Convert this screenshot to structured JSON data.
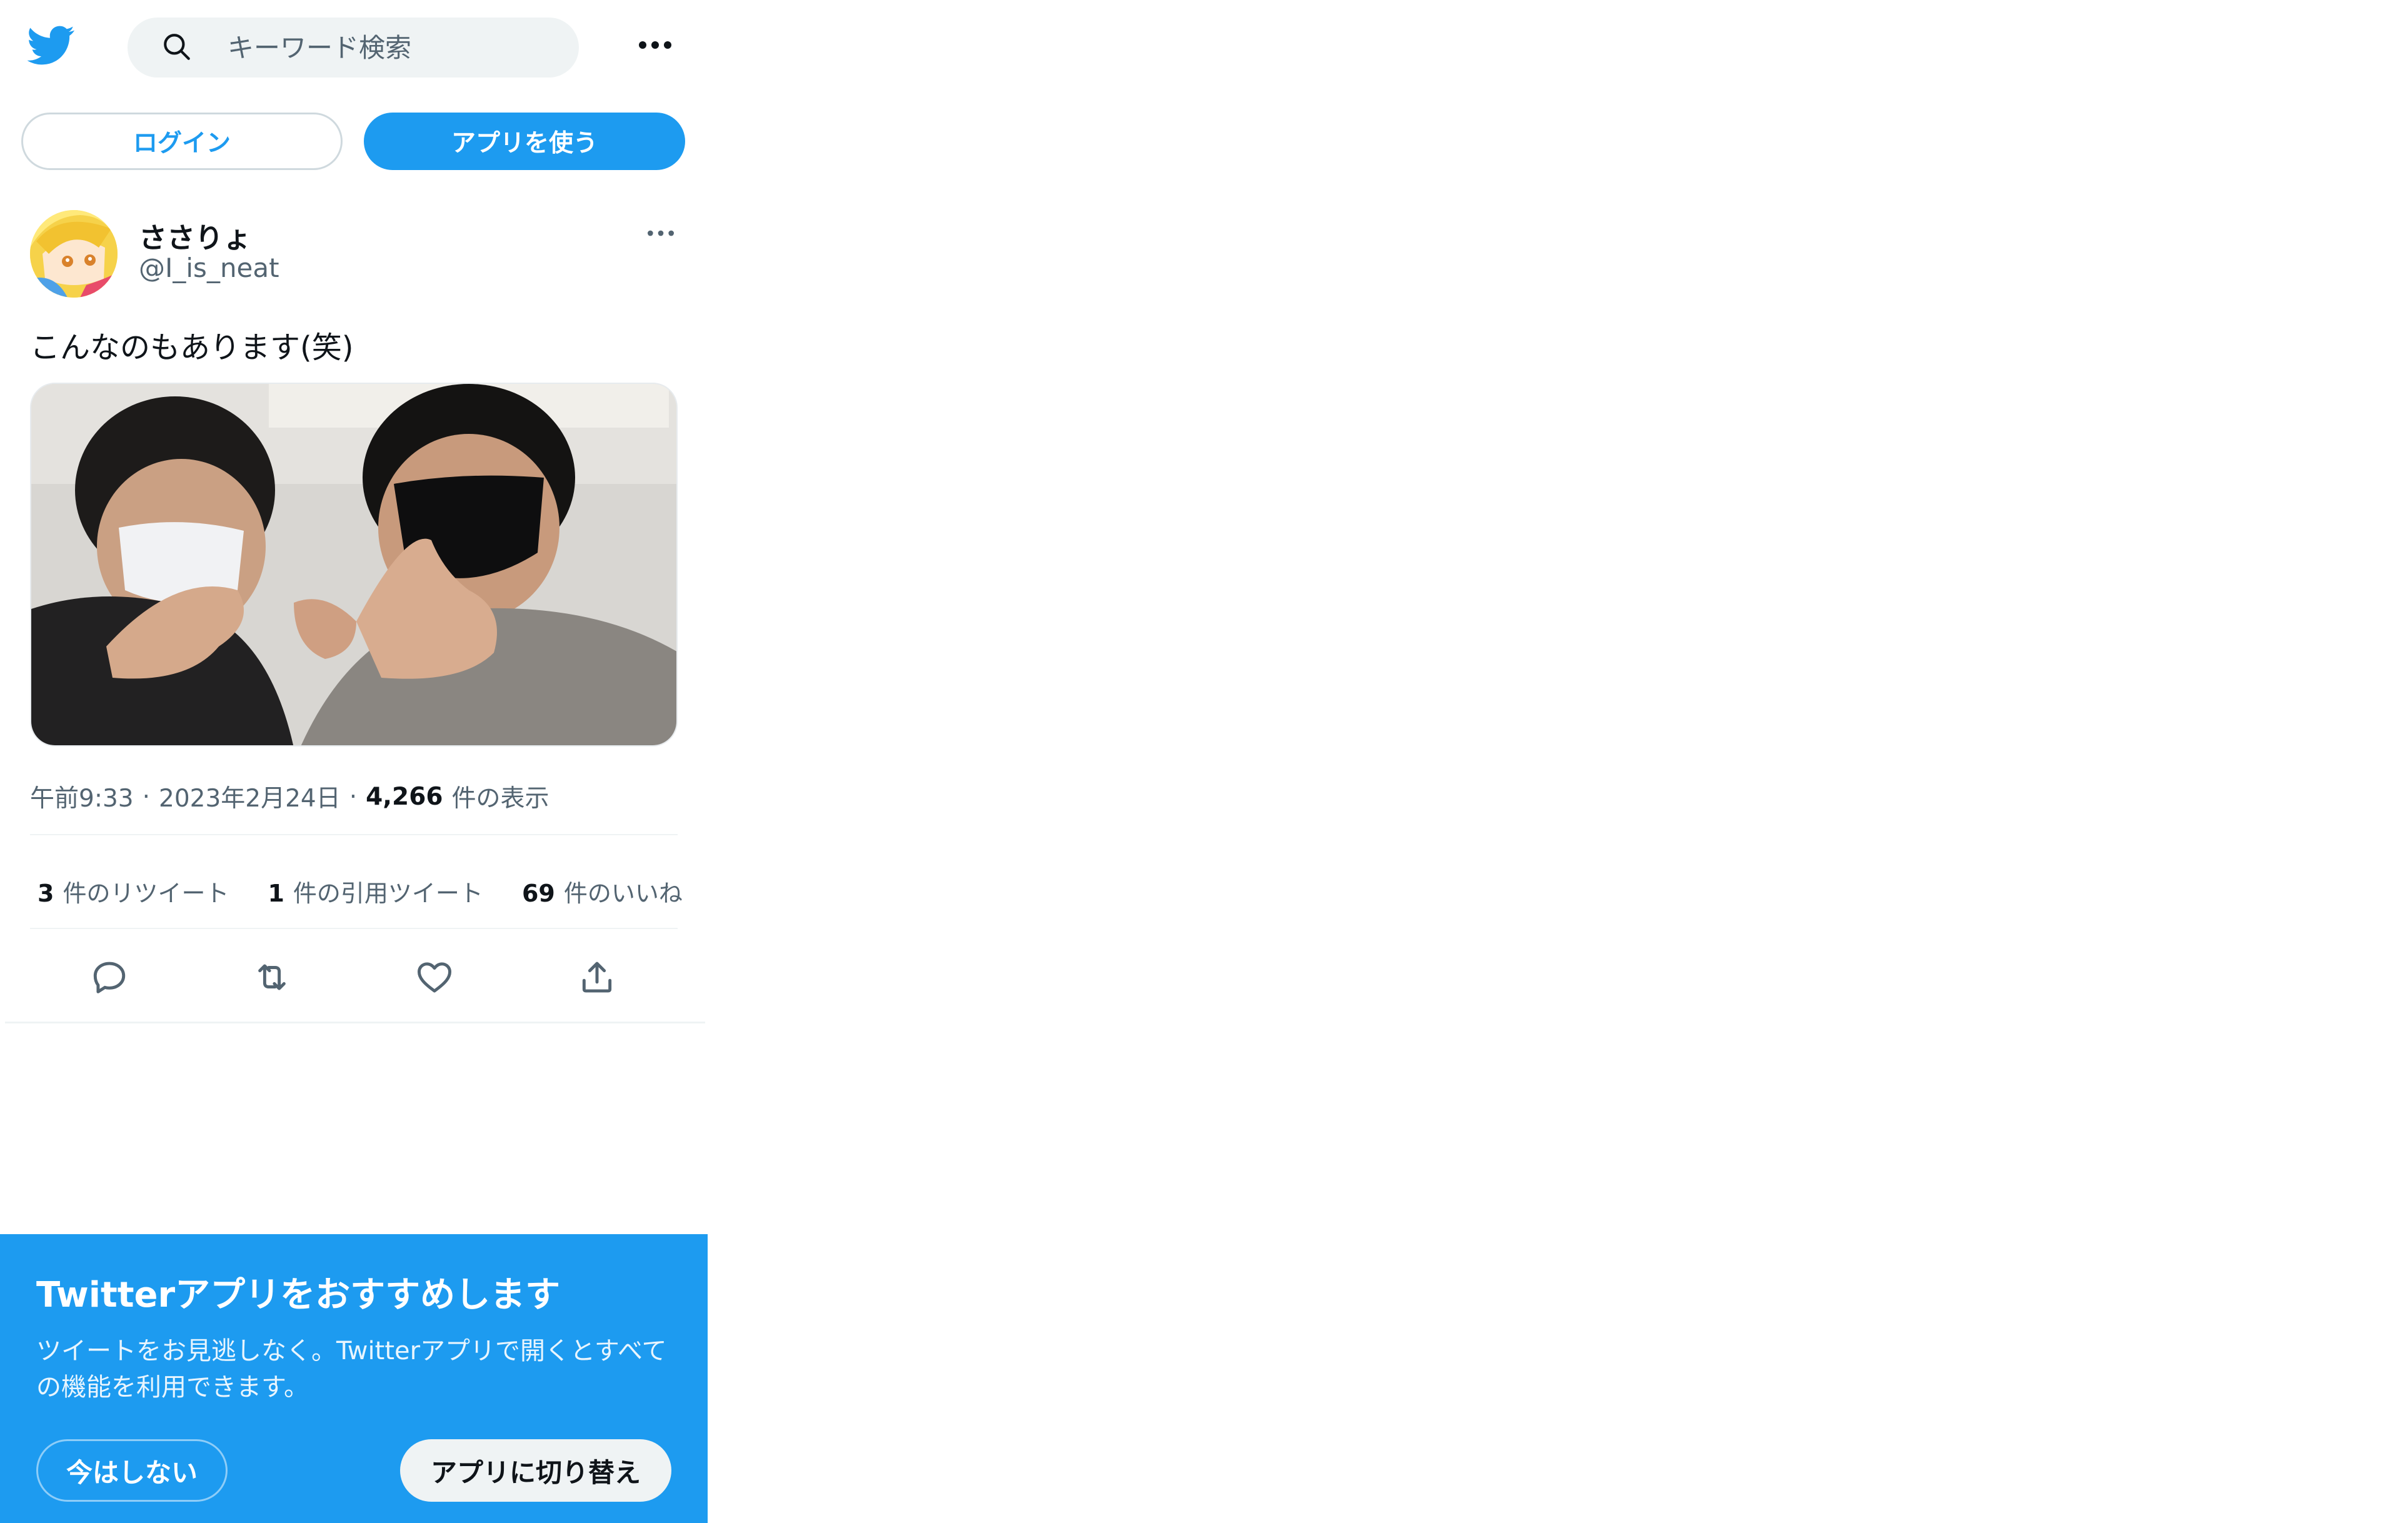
{
  "colors": {
    "brand": "#1d9bf0",
    "text_primary": "#0f1419",
    "text_secondary": "#536471"
  },
  "header": {
    "logo_icon": "twitter-bird-icon",
    "search_placeholder": "キーワード検索",
    "more_icon": "more-horizontal-icon"
  },
  "auth": {
    "login_label": "ログイン",
    "use_app_label": "アプリを使う"
  },
  "tweet": {
    "display_name": "ささりょ",
    "handle": "@I_is_neat",
    "text": "こんなのもあります(笑)",
    "time": "午前9:33",
    "date": "2023年2月24日",
    "views_count": "4,266",
    "views_label": "件の表示",
    "photo_icon": "tweet-photo",
    "stats": {
      "retweets_count": "3",
      "retweets_label": "件のリツイート",
      "quotes_count": "1",
      "quotes_label": "件の引用ツイート",
      "likes_count": "69",
      "likes_label": "件のいいね"
    },
    "actions": [
      "reply-icon",
      "retweet-icon",
      "like-icon",
      "share-icon"
    ]
  },
  "promo": {
    "title": "Twitterアプリをおすすめします",
    "body": "ツイートをお見逃しなく。Twitterアプリで開くとすべての機能を利用できます。",
    "not_now_label": "今はしない",
    "switch_label": "アプリに切り替え"
  }
}
